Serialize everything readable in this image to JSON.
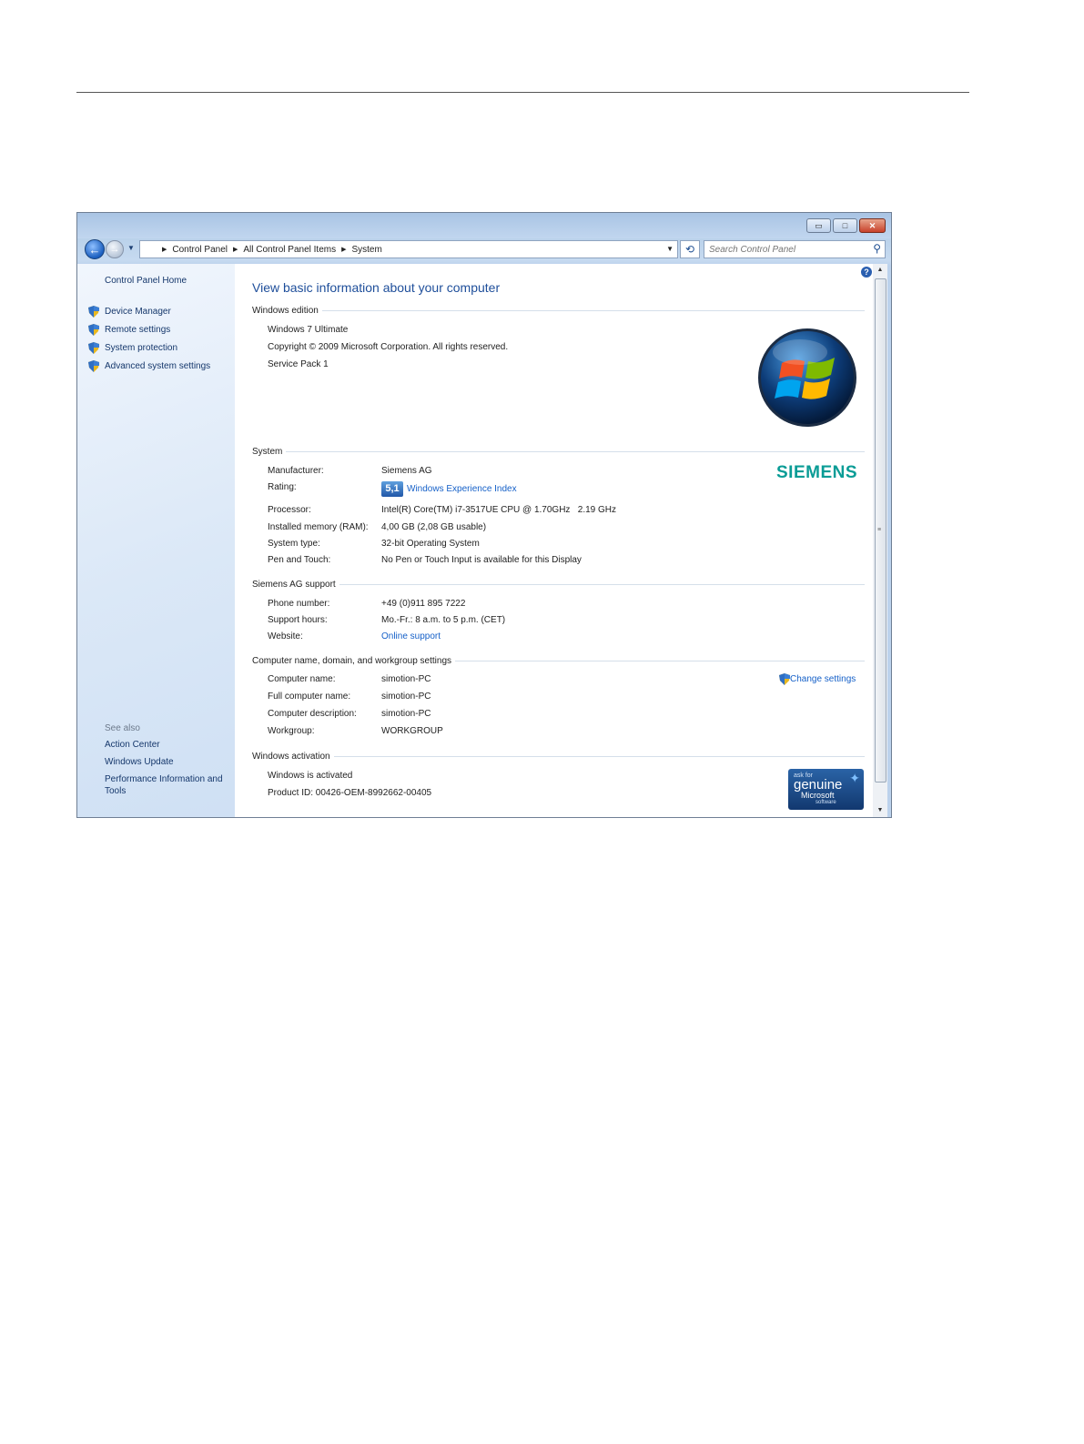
{
  "window": {
    "caption_buttons": {
      "minimize": "▭",
      "maximize": "□",
      "close": "✕"
    }
  },
  "nav": {
    "back_glyph": "←",
    "breadcrumb": [
      "Control Panel",
      "All Control Panel Items",
      "System"
    ],
    "search_placeholder": "Search Control Panel"
  },
  "sidebar": {
    "home": "Control Panel Home",
    "tasks": [
      {
        "label": "Device Manager",
        "icon": "shield-icon"
      },
      {
        "label": "Remote settings",
        "icon": "shield-icon"
      },
      {
        "label": "System protection",
        "icon": "shield-icon"
      },
      {
        "label": "Advanced system settings",
        "icon": "shield-icon"
      }
    ],
    "see_also_label": "See also",
    "see_also": [
      "Action Center",
      "Windows Update",
      "Performance Information and Tools"
    ]
  },
  "main": {
    "title": "View basic information about your computer",
    "help_glyph": "?",
    "windows_edition": {
      "heading": "Windows edition",
      "lines": [
        "Windows 7 Ultimate",
        "Copyright © 2009 Microsoft Corporation.  All rights reserved.",
        "Service Pack 1"
      ]
    },
    "system": {
      "heading": "System",
      "logo": "SIEMENS",
      "rows": [
        {
          "label": "Manufacturer:",
          "value": "Siemens AG"
        },
        {
          "label": "Rating:",
          "value": "5,1",
          "link": "Windows Experience Index"
        },
        {
          "label": "Processor:",
          "value": "Intel(R) Core(TM) i7-3517UE CPU @ 1.70GHz   2.19 GHz"
        },
        {
          "label": "Installed memory (RAM):",
          "value": "4,00 GB (2,08 GB usable)"
        },
        {
          "label": "System type:",
          "value": "32-bit Operating System"
        },
        {
          "label": "Pen and Touch:",
          "value": "No Pen or Touch Input is available for this Display"
        }
      ]
    },
    "support": {
      "heading": "Siemens AG support",
      "rows": [
        {
          "label": "Phone number:",
          "value": "+49 (0)911 895 7222"
        },
        {
          "label": "Support hours:",
          "value": "Mo.-Fr.: 8 a.m. to 5 p.m. (CET)"
        },
        {
          "label": "Website:",
          "value": "Online support"
        }
      ]
    },
    "computer_name": {
      "heading": "Computer name, domain, and workgroup settings",
      "change_settings": "Change settings",
      "rows": [
        {
          "label": "Computer name:",
          "value": "simotion-PC"
        },
        {
          "label": "Full computer name:",
          "value": "simotion-PC"
        },
        {
          "label": "Computer description:",
          "value": "simotion-PC"
        },
        {
          "label": "Workgroup:",
          "value": "WORKGROUP"
        }
      ]
    },
    "activation": {
      "heading": "Windows activation",
      "status": "Windows is activated",
      "product_id": "Product ID: 00426-OEM-8992662-00405",
      "genuine": {
        "ask_for": "ask for",
        "genuine": "genuine",
        "microsoft": "Microsoft",
        "software": "software"
      }
    }
  },
  "colors": {
    "link": "#1560c8",
    "title_blue": "#1e4e9a",
    "siemens_teal": "#0a9c96"
  }
}
